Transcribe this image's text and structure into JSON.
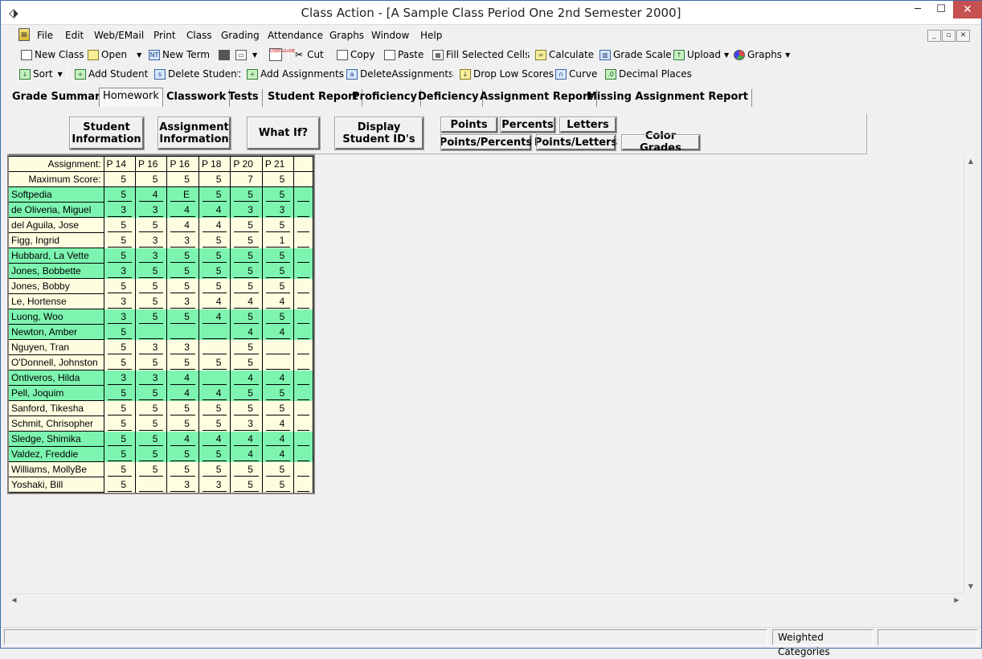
{
  "window": {
    "title": "Class Action - [A Sample Class Period One 2nd Semester 2000]",
    "min": "─",
    "max": "☐",
    "close": "✕"
  },
  "menu": [
    "File",
    "Edit",
    "Web/EMail",
    "Print",
    "Class",
    "Grading",
    "Attendance",
    "Graphs",
    "Window",
    "Help"
  ],
  "toolbar1": {
    "new_class": "New Class",
    "open": "Open",
    "new_term": "New Term",
    "user_guide": "USER GUIDE",
    "cut": "Cut",
    "copy": "Copy",
    "paste": "Paste",
    "fill_selected": "Fill Selected Cells",
    "calculate": "Calculate",
    "grade_scale": "Grade Scale",
    "upload": "Upload",
    "graphs": "Graphs"
  },
  "toolbar2": {
    "sort": "Sort",
    "add_student": "Add Student",
    "delete_student": "Delete Student",
    "add_assignments": "Add Assignments",
    "delete_assignments": "DeleteAssignments",
    "drop_low": "Drop Low Scores",
    "curve": "Curve",
    "decimal": "Decimal Places"
  },
  "tabs": [
    "Grade Summary",
    "Homework",
    "Classwork",
    "Tests",
    "Student Report",
    "Proficiency",
    "Deficiency",
    "Assignment Report",
    "Missing Assignment Report"
  ],
  "active_tab": "Homework",
  "panel_buttons": {
    "student_info_1": "Student",
    "student_info_2": "Information",
    "assignment_info_1": "Assignment",
    "assignment_info_2": "Information",
    "what_if": "What If?",
    "display_ids_1": "Display",
    "display_ids_2": "Student ID's",
    "points": "Points",
    "percents": "Percents",
    "letters": "Letters",
    "points_percents": "Points/Percents",
    "points_letters": "Points/Letters",
    "color_grades": "Color Grades"
  },
  "grid": {
    "assignment_label": "Assignment:",
    "max_label": "Maximum Score:",
    "assignments": [
      "P 14",
      "P 16",
      "P 16",
      "P 18",
      "P 20",
      "P 21",
      ""
    ],
    "max_scores": [
      "5",
      "5",
      "5",
      "5",
      "7",
      "5",
      ""
    ],
    "students": [
      {
        "name": "Softpedia",
        "scores": [
          "5",
          "4",
          "E",
          "5",
          "5",
          "5",
          ""
        ],
        "color": "green"
      },
      {
        "name": "de Oliveria, Miguel",
        "scores": [
          "3",
          "3",
          "4",
          "4",
          "3",
          "3",
          ""
        ],
        "color": "green"
      },
      {
        "name": "del Aguila, Jose",
        "scores": [
          "5",
          "5",
          "4",
          "4",
          "5",
          "5",
          ""
        ],
        "color": "yellow"
      },
      {
        "name": "Figg, Ingrid",
        "scores": [
          "5",
          "3",
          "3",
          "5",
          "5",
          "1",
          ""
        ],
        "color": "yellow"
      },
      {
        "name": "Hubbard, La Vette",
        "scores": [
          "5",
          "3",
          "5",
          "5",
          "5",
          "5",
          ""
        ],
        "color": "green"
      },
      {
        "name": "Jones, Bobbette",
        "scores": [
          "3",
          "5",
          "5",
          "5",
          "5",
          "5",
          ""
        ],
        "color": "green"
      },
      {
        "name": "Jones, Bobby",
        "scores": [
          "5",
          "5",
          "5",
          "5",
          "5",
          "5",
          ""
        ],
        "color": "yellow"
      },
      {
        "name": "Le, Hortense",
        "scores": [
          "3",
          "5",
          "3",
          "4",
          "4",
          "4",
          ""
        ],
        "color": "yellow"
      },
      {
        "name": "Luong, Woo",
        "scores": [
          "3",
          "5",
          "5",
          "4",
          "5",
          "5",
          ""
        ],
        "color": "green"
      },
      {
        "name": "Newton, Amber",
        "scores": [
          "5",
          "",
          "",
          "",
          "4",
          "4",
          ""
        ],
        "color": "green"
      },
      {
        "name": "Nguyen, Tran",
        "scores": [
          "5",
          "3",
          "3",
          "",
          "5",
          "",
          ""
        ],
        "color": "yellow"
      },
      {
        "name": "O'Donnell, Johnston",
        "scores": [
          "5",
          "5",
          "5",
          "5",
          "5",
          "",
          ""
        ],
        "color": "yellow"
      },
      {
        "name": "Ontiveros, Hilda",
        "scores": [
          "3",
          "3",
          "4",
          "",
          "4",
          "4",
          ""
        ],
        "color": "green"
      },
      {
        "name": "Pell, Joquim",
        "scores": [
          "5",
          "5",
          "4",
          "4",
          "5",
          "5",
          ""
        ],
        "color": "green"
      },
      {
        "name": "Sanford, Tikesha",
        "scores": [
          "5",
          "5",
          "5",
          "5",
          "5",
          "5",
          ""
        ],
        "color": "yellow"
      },
      {
        "name": "Schmit, Chrisopher",
        "scores": [
          "5",
          "5",
          "5",
          "5",
          "3",
          "4",
          ""
        ],
        "color": "yellow"
      },
      {
        "name": "Sledge, Shimika",
        "scores": [
          "5",
          "5",
          "4",
          "4",
          "4",
          "4",
          ""
        ],
        "color": "green"
      },
      {
        "name": "Valdez, Freddie",
        "scores": [
          "5",
          "5",
          "5",
          "5",
          "4",
          "4",
          ""
        ],
        "color": "green"
      },
      {
        "name": "Williams, MollyBe",
        "scores": [
          "5",
          "5",
          "5",
          "5",
          "5",
          "5",
          ""
        ],
        "color": "yellow"
      },
      {
        "name": "Yoshaki, Bill",
        "scores": [
          "5",
          "",
          "3",
          "3",
          "5",
          "5",
          ""
        ],
        "color": "yellow"
      }
    ],
    "colors": {
      "green": "#7df5b0",
      "yellow": "#fffde0"
    }
  },
  "statusbar": {
    "weighted": "Weighted Categories"
  }
}
